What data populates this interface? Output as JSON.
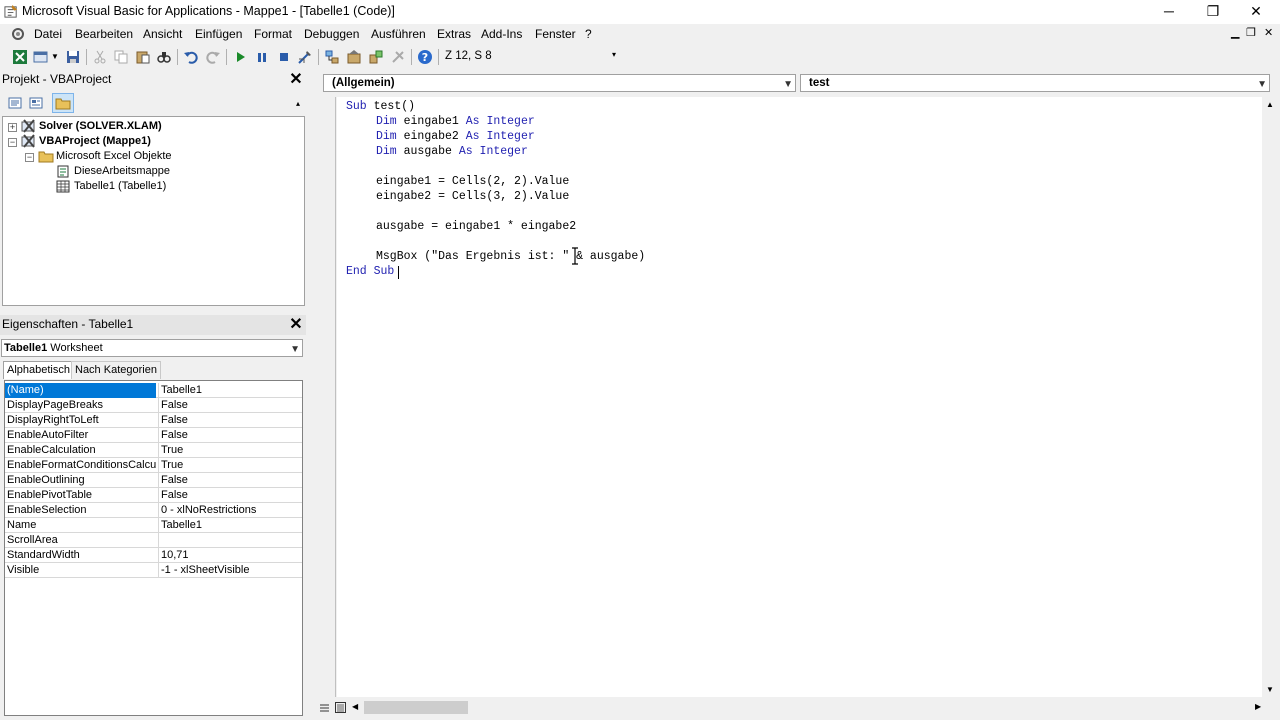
{
  "window": {
    "title": "Microsoft Visual Basic for Applications - Mappe1 - [Tabelle1 (Code)]",
    "minimize": "─",
    "restore": "❐",
    "close": "✕"
  },
  "menu": {
    "items": [
      "Datei",
      "Bearbeiten",
      "Ansicht",
      "Einfügen",
      "Format",
      "Debuggen",
      "Ausführen",
      "Extras",
      "Add-Ins",
      "Fenster",
      "?"
    ],
    "mdi_minimize": "▁",
    "mdi_restore": "❐",
    "mdi_close": "✕"
  },
  "toolbar": {
    "position": "Z 12, S 8"
  },
  "project": {
    "title": "Projekt - VBAProject",
    "tree": [
      {
        "label": "Solver (SOLVER.XLAM)",
        "bold": true
      },
      {
        "label": "VBAProject (Mappe1)",
        "bold": true
      },
      {
        "label": "Microsoft Excel Objekte",
        "bold": false
      },
      {
        "label": "DieseArbeitsmappe",
        "bold": false
      },
      {
        "label": "Tabelle1 (Tabelle1)",
        "bold": false
      }
    ]
  },
  "properties": {
    "title": "Eigenschaften - Tabelle1",
    "object_name": "Tabelle1",
    "object_type": "Worksheet",
    "tabs": [
      "Alphabetisch",
      "Nach Kategorien"
    ],
    "rows": [
      {
        "name": "(Name)",
        "value": "Tabelle1"
      },
      {
        "name": "DisplayPageBreaks",
        "value": "False"
      },
      {
        "name": "DisplayRightToLeft",
        "value": "False"
      },
      {
        "name": "EnableAutoFilter",
        "value": "False"
      },
      {
        "name": "EnableCalculation",
        "value": "True"
      },
      {
        "name": "EnableFormatConditionsCalculation",
        "value": "True"
      },
      {
        "name": "EnableOutlining",
        "value": "False"
      },
      {
        "name": "EnablePivotTable",
        "value": "False"
      },
      {
        "name": "EnableSelection",
        "value": "0 - xlNoRestrictions"
      },
      {
        "name": "Name",
        "value": "Tabelle1"
      },
      {
        "name": "ScrollArea",
        "value": ""
      },
      {
        "name": "StandardWidth",
        "value": "10,71"
      },
      {
        "name": "Visible",
        "value": "-1 - xlSheetVisible"
      }
    ]
  },
  "code": {
    "object_combo": "(Allgemein)",
    "procedure_combo": "test",
    "lines": [
      {
        "kw": "Sub",
        "rest": " test()",
        "indent": 0
      },
      {
        "kw": "Dim",
        "mid": " eingabe1 ",
        "kw2": "As Integer",
        "indent": 1
      },
      {
        "kw": "Dim",
        "mid": " eingabe2 ",
        "kw2": "As Integer",
        "indent": 1
      },
      {
        "kw": "Dim",
        "mid": " ausgabe ",
        "kw2": "As Integer",
        "indent": 1
      },
      {
        "text": "",
        "indent": 1
      },
      {
        "text": "eingabe1 = Cells(2, 2).Value",
        "indent": 1
      },
      {
        "text": "eingabe2 = Cells(3, 2).Value",
        "indent": 1
      },
      {
        "text": "",
        "indent": 1
      },
      {
        "text": "ausgabe = eingabe1 * eingabe2",
        "indent": 1
      },
      {
        "text": "",
        "indent": 1
      },
      {
        "text": "MsgBox (\"Das Ergebnis ist: \" & ausgabe)",
        "indent": 1
      },
      {
        "kw": "End Sub",
        "rest": "",
        "indent": 0
      }
    ]
  }
}
